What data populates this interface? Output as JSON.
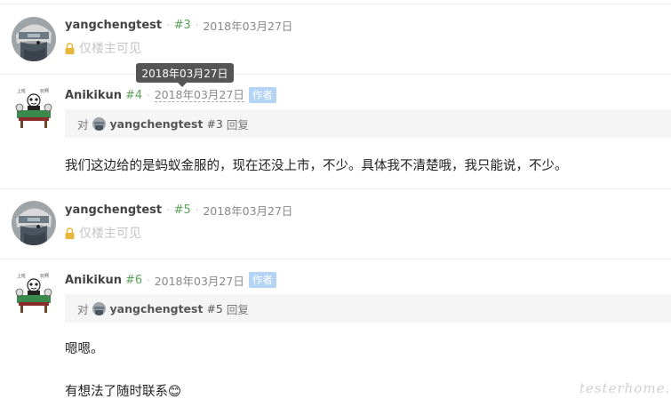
{
  "tooltip": {
    "text": "2018年03月27日"
  },
  "replies": [
    {
      "user": "yangchengtest",
      "floor": "#3",
      "dot": "·",
      "time": "2018年03月27日",
      "private_text": "仅楼主可见"
    },
    {
      "user": "Anikikun",
      "floor": "#4",
      "dot": "·",
      "time": "2018年03月27日",
      "badge": "作者",
      "quote": {
        "prefix": "对",
        "user": "yangchengtest",
        "floor": "#3",
        "suffix": "回复"
      },
      "body": [
        "我们这边给的是蚂蚁金服的，现在还没上市，不少。具体我不清楚哦，我只能说，不少。"
      ]
    },
    {
      "user": "yangchengtest",
      "floor": "#5",
      "dot": "·",
      "time": "2018年03月27日",
      "private_text": "仅楼主可见"
    },
    {
      "user": "Anikikun",
      "floor": "#6",
      "dot": "·",
      "time": "2018年03月27日",
      "badge": "作者",
      "quote": {
        "prefix": "对",
        "user": "yangchengtest",
        "floor": "#5",
        "suffix": "回复"
      },
      "body": [
        "嗯嗯。",
        "有想法了随时联系😊"
      ]
    }
  ],
  "colors": {
    "floor": "#5aa35a",
    "badge": "#b3d4f5",
    "lock": "#e8b83a",
    "private": "#c5c5c5"
  },
  "watermark": "testerhome.com"
}
